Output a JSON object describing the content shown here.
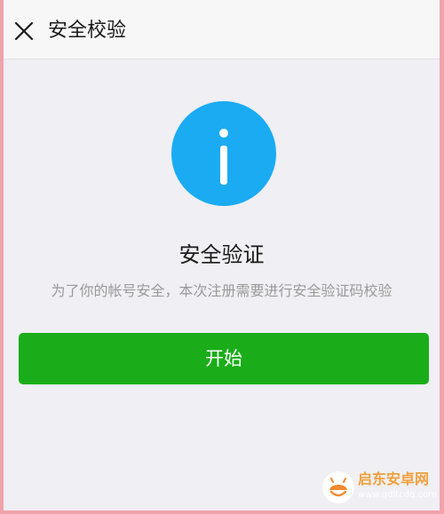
{
  "header": {
    "close_icon": "close-icon",
    "title": "安全校验"
  },
  "main": {
    "icon": "info-icon",
    "icon_color": "#1aabf3",
    "title": "安全验证",
    "description": "为了你的帐号安全，本次注册需要进行安全验证码校验",
    "start_button": "开始",
    "button_color": "#1aad19"
  },
  "watermark": {
    "name": "启东安卓网",
    "url": "www.qdltcdq.com"
  }
}
